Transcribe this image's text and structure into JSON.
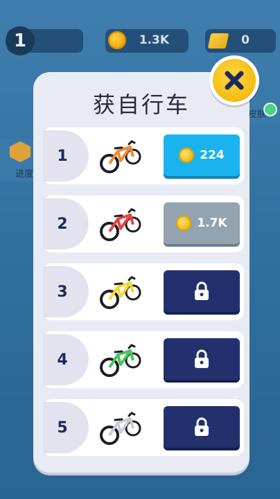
{
  "hud": {
    "level": "1",
    "coins": "1.3K",
    "gems": "0"
  },
  "side": {
    "left_label": "进度",
    "right_label": "皮肤"
  },
  "modal": {
    "title": "获自行车",
    "rows": [
      {
        "num": "1",
        "action": "price",
        "price": "224",
        "bike_color": "#f08a3a"
      },
      {
        "num": "2",
        "action": "price",
        "price": "1.7K",
        "bike_color": "#e2463f"
      },
      {
        "num": "3",
        "action": "locked",
        "price": "",
        "bike_color": "#f2d93a"
      },
      {
        "num": "4",
        "action": "locked",
        "price": "",
        "bike_color": "#47c45a"
      },
      {
        "num": "5",
        "action": "locked",
        "price": "",
        "bike_color": "#ffffff"
      }
    ]
  },
  "colors": {
    "accent_blue": "#1ab3ef",
    "locked_navy": "#22316e",
    "close_yellow": "#f6bb0d"
  }
}
